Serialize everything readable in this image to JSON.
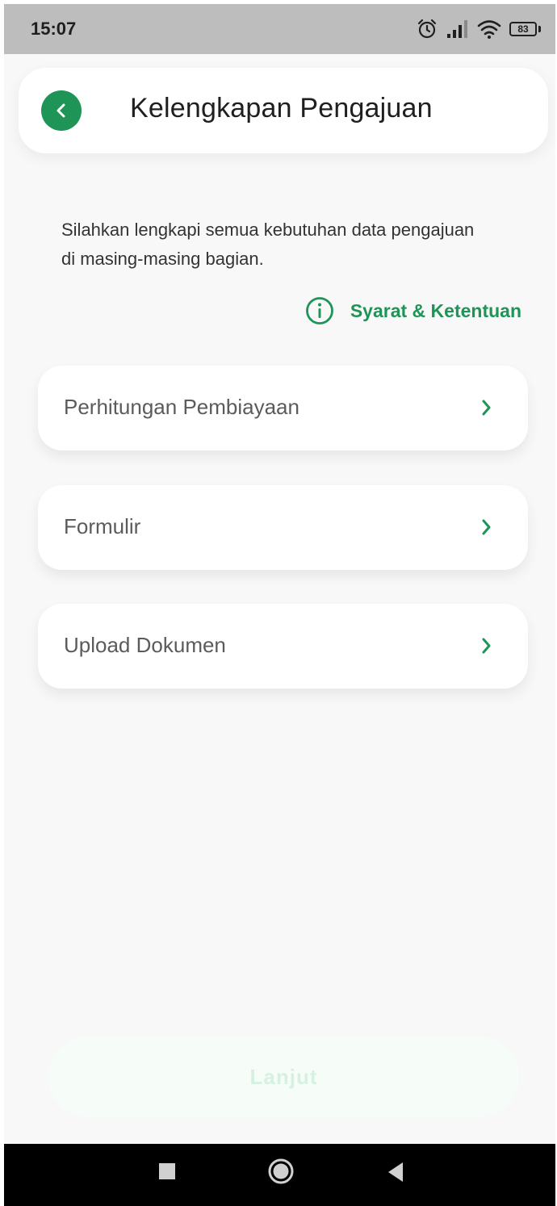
{
  "status_bar": {
    "time": "15:07",
    "battery": "83"
  },
  "header": {
    "title": "Kelengkapan Pengajuan"
  },
  "intro": {
    "text": "Silahkan lengkapi semua kebutuhan data pengajuan di masing-masing bagian."
  },
  "terms": {
    "label": "Syarat & Ketentuan"
  },
  "menu": {
    "items": [
      {
        "label": "Perhitungan Pembiayaan"
      },
      {
        "label": "Formulir"
      },
      {
        "label": "Upload Dokumen"
      }
    ]
  },
  "footer": {
    "continue_label": "Lanjut"
  },
  "colors": {
    "accent": "#1e9457",
    "background": "#f8f8f8",
    "disabled_button": "#f6fdf9"
  },
  "icons": {
    "back": "chevron-left-icon",
    "terms": "info-circle-icon",
    "menu": "chevron-right-icon"
  }
}
